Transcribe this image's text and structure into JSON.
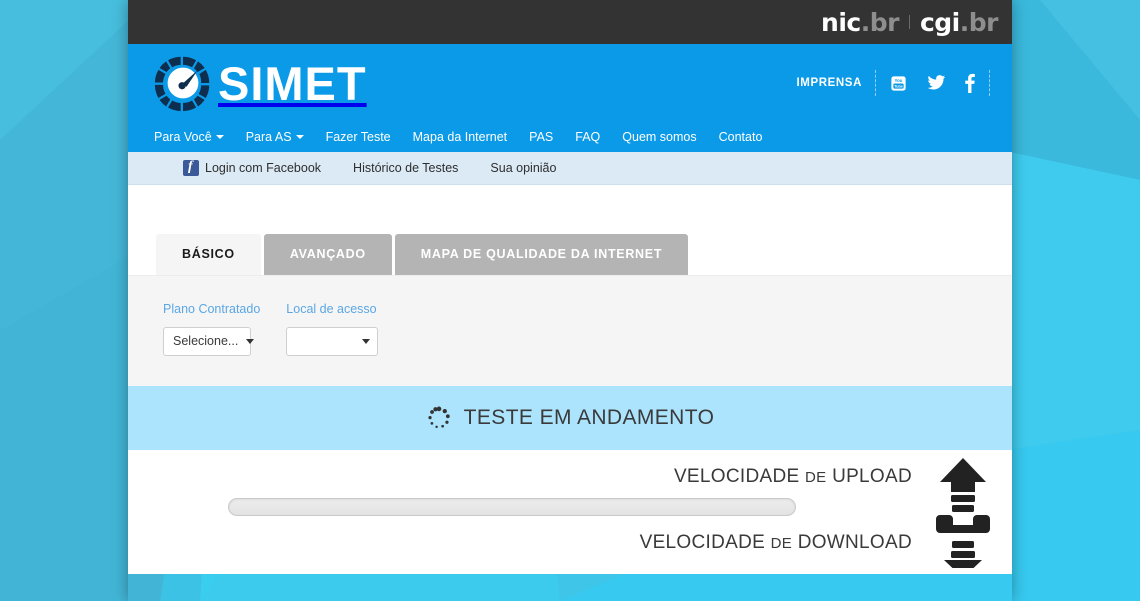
{
  "topbar": {
    "logos": [
      {
        "name": "nic",
        "prefix": "nic",
        "suffix": ".br"
      },
      {
        "name": "cgi",
        "prefix": "cgi",
        "suffix": ".br"
      }
    ]
  },
  "header": {
    "brand_name": "SIMET",
    "brand_icon": "speedometer-icon",
    "press_label": "IMPRENSA",
    "social": [
      {
        "name": "youtube-icon",
        "label": "YouTube"
      },
      {
        "name": "twitter-icon",
        "label": "Twitter"
      },
      {
        "name": "facebook-icon",
        "label": "Facebook"
      }
    ],
    "nav": [
      {
        "label": "Para Você",
        "dropdown": true
      },
      {
        "label": "Para AS",
        "dropdown": true
      },
      {
        "label": "Fazer Teste",
        "dropdown": false
      },
      {
        "label": "Mapa da Internet",
        "dropdown": false
      },
      {
        "label": "PAS",
        "dropdown": false
      },
      {
        "label": "FAQ",
        "dropdown": false
      },
      {
        "label": "Quem somos",
        "dropdown": false
      },
      {
        "label": "Contato",
        "dropdown": false
      }
    ]
  },
  "subbar": {
    "facebook_login": "Login com Facebook",
    "history": "Histórico de Testes",
    "opinion": "Sua opinião"
  },
  "tabs": [
    {
      "label": "BÁSICO",
      "active": true
    },
    {
      "label": "AVANÇADO",
      "active": false
    },
    {
      "label": "MAPA DE QUALIDADE DA INTERNET",
      "active": false
    }
  ],
  "form": {
    "plan": {
      "label": "Plano Contratado",
      "value": "Selecione..."
    },
    "location": {
      "label": "Local de acesso",
      "value": ""
    }
  },
  "test_status": {
    "label": "TESTE EM ANDAMENTO",
    "spinner": "loading-spinner-icon"
  },
  "speed": {
    "upload": {
      "title_main": "VELOCIDADE",
      "title_de": "DE",
      "title_kind": "UPLOAD",
      "progress_percent": 0
    },
    "download": {
      "title_main": "VELOCIDADE",
      "title_de": "DE",
      "title_kind": "DOWNLOAD"
    },
    "icon": "upload-download-arrows-icon"
  },
  "colors": {
    "header_blue": "#0b9ae8",
    "topbar_dark": "#333333",
    "subbar_blue": "#dceaf6",
    "panel_gray": "#f5f5f5",
    "banner_blue": "#ade4fd",
    "tab_inactive": "#b4b4b4",
    "label_blue": "#5ba7e5",
    "background_cyan": "#3bc7e8"
  }
}
